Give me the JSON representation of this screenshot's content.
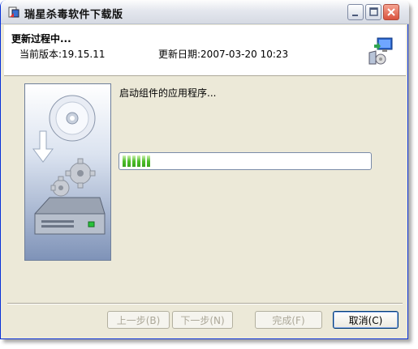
{
  "window": {
    "title": "瑞星杀毒软件下载版"
  },
  "header": {
    "title": "更新过程中...",
    "version_text": "当前版本:19.15.11",
    "date_text": "更新日期:2007-03-20 10:23"
  },
  "main": {
    "status_text": "启动组件的应用程序...",
    "progress": 0.13
  },
  "buttons": {
    "prev": "上一步(B)",
    "next": "下一步(N)",
    "finish": "完成(F)",
    "cancel": "取消(C)"
  },
  "colors": {
    "progress_green": "#4fbf2b",
    "window_bg": "#ECE9D8"
  }
}
